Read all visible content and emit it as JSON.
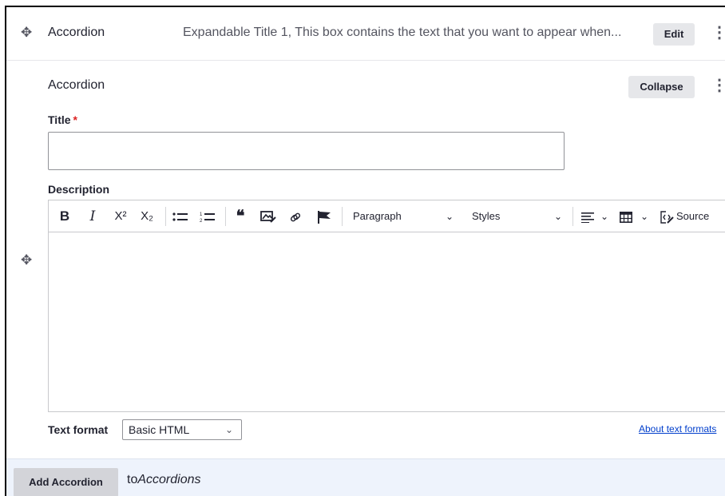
{
  "collapsed_item": {
    "label": "Accordion",
    "summary": "Expandable Title 1, This box contains the text that you want to appear when...",
    "edit_label": "Edit"
  },
  "expanded_item": {
    "label": "Accordion",
    "collapse_label": "Collapse"
  },
  "title_field": {
    "label": "Title",
    "required_marker": "*",
    "value": ""
  },
  "description_field": {
    "label": "Description",
    "toolbar": {
      "bold": "B",
      "italic": "I",
      "superscript": "X²",
      "subscript": "X₂",
      "bulleted_list_icon": "bulleted-list-icon",
      "numbered_list_icon": "numbered-list-icon",
      "blockquote": "❝",
      "image_icon": "image-icon",
      "link_icon": "link-icon",
      "anchor_icon": "flag-icon",
      "heading_dropdown": "Paragraph",
      "styles_dropdown": "Styles",
      "alignment_icon": "align-icon",
      "table_icon": "table-icon",
      "source_label": "Source"
    },
    "content": ""
  },
  "text_format": {
    "label": "Text format",
    "selected": "Basic HTML",
    "about_link": "About text formats"
  },
  "footer": {
    "add_button": "Add Accordion",
    "to_prefix": "to",
    "to_target": "Accordions"
  },
  "colors": {
    "required": "#dc2323",
    "link": "#003ecc",
    "footer_bg": "#eef3fc"
  }
}
